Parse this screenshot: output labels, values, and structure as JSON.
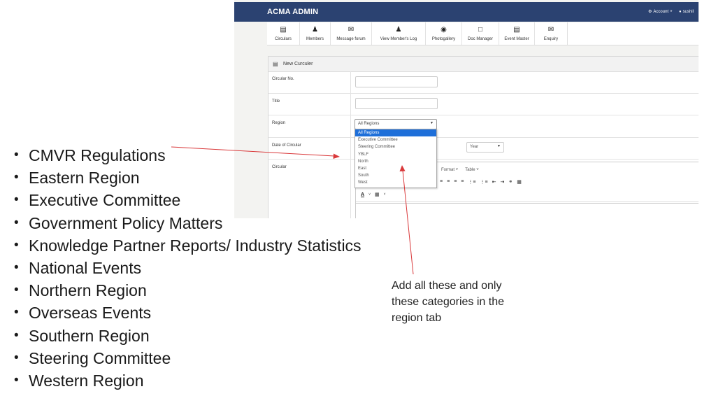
{
  "app": {
    "brand": "ACMA ADMIN",
    "account_label": "Account",
    "user_label": "sushil",
    "toolbar": [
      {
        "label": "Circulars",
        "icon": "list-icon"
      },
      {
        "label": "Members",
        "icon": "user-icon"
      },
      {
        "label": "Message forum",
        "icon": "envelope-icon"
      },
      {
        "label": "View Member's Log",
        "icon": "user-icon"
      },
      {
        "label": "Photogallery",
        "icon": "camera-icon"
      },
      {
        "label": "Doc Manager",
        "icon": "document-icon"
      },
      {
        "label": "Event Master",
        "icon": "list-icon"
      },
      {
        "label": "Enquiry",
        "icon": "envelope-icon"
      }
    ],
    "panel_title": "New Curculer",
    "form": {
      "circular_no_label": "Circular No.",
      "title_label": "Title",
      "region_label": "Region",
      "date_label": "Date of Circular",
      "circular_label": "Circular",
      "year_value": "Year",
      "region_selected": "All Regions",
      "region_options": [
        "All Regions",
        "Executive Committee",
        "Steering Committee",
        "YBLF",
        "North",
        "East",
        "South",
        "West"
      ]
    },
    "editor": {
      "format_label": "Format",
      "table_label": "Table"
    }
  },
  "bullets": [
    "CMVR Regulations",
    "Eastern Region",
    "Executive Committee",
    "Government Policy Matters",
    "Knowledge Partner Reports/ Industry Statistics",
    "National Events",
    "Northern Region",
    "Overseas Events",
    "Southern Region",
    "Steering Committee",
    "Western Region"
  ],
  "note": {
    "line1": "Add all these and only",
    "line2": "these categories in the",
    "line3": "region tab"
  },
  "colors": {
    "topbar": "#2b4271",
    "selected_option": "#1e6fd9",
    "arrow": "#d9383a"
  }
}
